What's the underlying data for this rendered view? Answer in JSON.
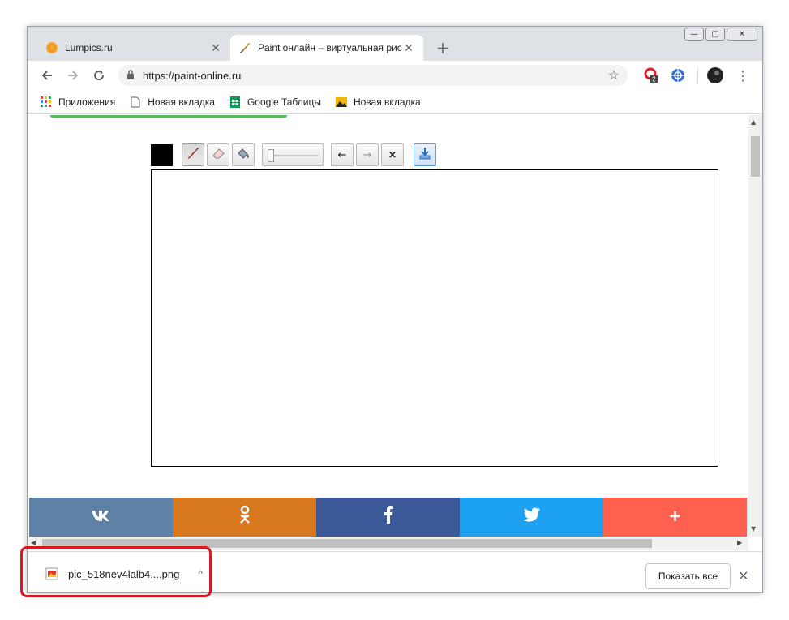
{
  "browser": {
    "tabs": [
      {
        "title": "Lumpics.ru",
        "icon": "orange-circle-icon",
        "active": false
      },
      {
        "title": "Paint онлайн – виртуальная рис",
        "icon": "paintbrush-icon",
        "active": true
      }
    ],
    "new_tab_symbol": "+",
    "window_controls": {
      "minimize": "—",
      "maximize": "▢",
      "close": "✕"
    },
    "address": {
      "url": "https://paint-online.ru"
    },
    "extension_badge": "2"
  },
  "bookmarks": [
    {
      "label": "Приложения",
      "icon": "apps-grid-icon"
    },
    {
      "label": "Новая вкладка",
      "icon": "page-icon"
    },
    {
      "label": "Google Таблицы",
      "icon": "sheets-icon"
    },
    {
      "label": "Новая вкладка",
      "icon": "image-icon"
    }
  ],
  "paint": {
    "current_color": "#000000",
    "tools": [
      "brush",
      "eraser",
      "fill"
    ],
    "undo_symbol": "←",
    "redo_symbol": "→",
    "clear_symbol": "×"
  },
  "social": {
    "vk": "вк",
    "ok": "ок",
    "fb": "f",
    "tw": "twitter",
    "plus": "+"
  },
  "colors": {
    "vk": "#5e81a8",
    "ok": "#d7781f",
    "fb": "#3b5998",
    "tw": "#1da1f2",
    "plus": "#ff6150",
    "highlight": "#d9191f"
  },
  "download_bar": {
    "file_name": "pic_518nev4lalb4....png",
    "show_all_label": "Показать все",
    "close_symbol": "✕"
  }
}
